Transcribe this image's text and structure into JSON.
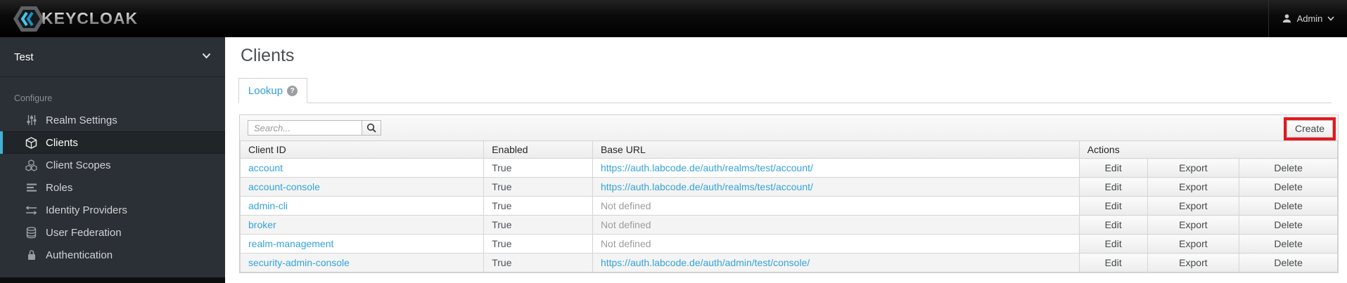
{
  "topbar": {
    "logo_text": "KEYCLOAK",
    "user": {
      "name": "Admin"
    }
  },
  "sidebar": {
    "realm": "Test",
    "section_label": "Configure",
    "items": [
      {
        "label": "Realm Settings",
        "icon": "sliders-icon"
      },
      {
        "label": "Clients",
        "icon": "cube-icon",
        "selected": true
      },
      {
        "label": "Client Scopes",
        "icon": "cubes-icon"
      },
      {
        "label": "Roles",
        "icon": "list-icon"
      },
      {
        "label": "Identity Providers",
        "icon": "exchange-icon"
      },
      {
        "label": "User Federation",
        "icon": "database-icon"
      },
      {
        "label": "Authentication",
        "icon": "lock-icon"
      }
    ]
  },
  "page": {
    "title": "Clients",
    "tab_label": "Lookup",
    "help_glyph": "?"
  },
  "toolbar": {
    "search_placeholder": "Search...",
    "create_label": "Create"
  },
  "table": {
    "headers": {
      "client_id": "Client ID",
      "enabled": "Enabled",
      "base_url": "Base URL",
      "actions": "Actions"
    },
    "action_labels": [
      "Edit",
      "Export",
      "Delete"
    ],
    "rows": [
      {
        "client_id": "account",
        "enabled": "True",
        "base_url": "https://auth.labcode.de/auth/realms/test/account/",
        "url_is_link": true
      },
      {
        "client_id": "account-console",
        "enabled": "True",
        "base_url": "https://auth.labcode.de/auth/realms/test/account/",
        "url_is_link": true
      },
      {
        "client_id": "admin-cli",
        "enabled": "True",
        "base_url": "Not defined",
        "url_is_link": false
      },
      {
        "client_id": "broker",
        "enabled": "True",
        "base_url": "Not defined",
        "url_is_link": false
      },
      {
        "client_id": "realm-management",
        "enabled": "True",
        "base_url": "Not defined",
        "url_is_link": false
      },
      {
        "client_id": "security-admin-console",
        "enabled": "True",
        "base_url": "https://auth.labcode.de/auth/admin/test/console/",
        "url_is_link": true
      }
    ]
  },
  "colors": {
    "accent_blue": "#35a3dc",
    "nav_selected_border": "#41b0d5",
    "annotation_red": "#e4181e"
  }
}
